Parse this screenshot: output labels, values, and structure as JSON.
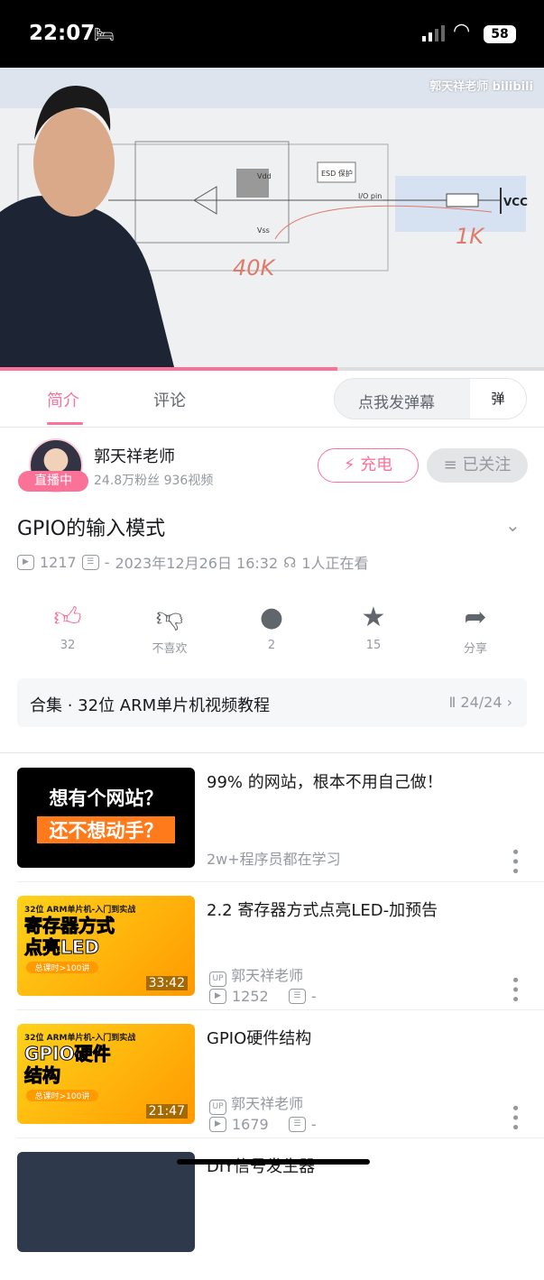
{
  "status": {
    "time": "22:07",
    "battery": "58"
  },
  "video": {
    "watermark": "郭天祥老师 bilibili",
    "progress_percent": 62,
    "board": {
      "vdd": "Vdd",
      "vss": "Vss",
      "esd": "ESD 保护",
      "io": "I/O pin",
      "vcc": "VCC",
      "r1": "40K",
      "r2": "1K"
    }
  },
  "tabs": [
    {
      "label": "简介"
    },
    {
      "label": "评论"
    }
  ],
  "danmu": {
    "placeholder": "点我发弹幕",
    "icon": "弹"
  },
  "uploader": {
    "name": "郭天祥老师",
    "live": "直播中",
    "stats": "24.8万粉丝  936视频",
    "charge": "充电",
    "follow": "已关注"
  },
  "video_info": {
    "title": "GPIO的输入模式",
    "views": "1217",
    "danmaku": "-",
    "date": "2023年12月26日 16:32",
    "watching": "1人正在看"
  },
  "actions": [
    {
      "icon": "thumb-up",
      "label": "32"
    },
    {
      "icon": "thumb-down",
      "label": "不喜欢"
    },
    {
      "icon": "coin",
      "label": "2"
    },
    {
      "icon": "star",
      "label": "15"
    },
    {
      "icon": "share",
      "label": "分享"
    }
  ],
  "collection": {
    "title": "合集 · 32位 ARM单片机视频教程",
    "count": "24/24"
  },
  "colors": {
    "accent": "#fb7299"
  },
  "list": [
    {
      "title": "99%  的网站，根本不用自己做！",
      "sub": "2w+程序员都在学习",
      "thumb_line1": "想有个网站？",
      "thumb_line2": "还不想动手？"
    },
    {
      "title": "2.2  寄存器方式点亮LED-加预告",
      "up": "郭天祥老师",
      "views": "1252",
      "danmaku": "-",
      "duration": "33:42",
      "thumb_top": "32位 ARM单片机-入门到实战",
      "thumb_main": "寄存器方式\n点亮LED",
      "thumb_badge": "总课时>100讲"
    },
    {
      "title": "GPIO硬件结构",
      "up": "郭天祥老师",
      "views": "1679",
      "danmaku": "-",
      "duration": "21:47",
      "thumb_top": "32位 ARM单片机-入门到实战",
      "thumb_main": "GPIO硬件\n结构",
      "thumb_badge": "总课时>100讲"
    },
    {
      "title": "DIY信号发生器"
    }
  ]
}
